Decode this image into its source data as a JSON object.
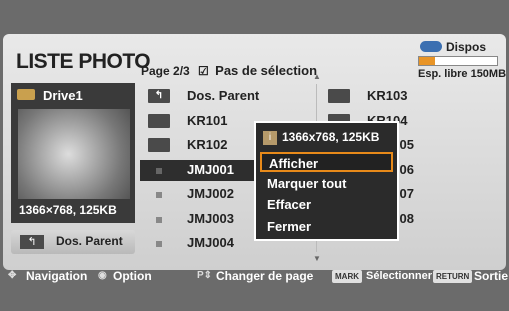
{
  "header": {
    "title": "LISTE PHOTO",
    "page": "Page 2/3",
    "checkbox_glyph": "☑",
    "selection_label": "Pas de sélection",
    "device_label": "Dispos USB",
    "free_space": "Esp. libre 150MB",
    "device_usage_fraction": 0.2
  },
  "preview": {
    "drive_name": "Drive1",
    "resolution": "1366×768, 125KB"
  },
  "parent_button": {
    "label": "Dos. Parent"
  },
  "list": {
    "left": [
      {
        "name": "Dos. Parent",
        "kind": "parent"
      },
      {
        "name": "KR101",
        "kind": "folder"
      },
      {
        "name": "KR102",
        "kind": "folder"
      },
      {
        "name": "JMJ001",
        "kind": "photo",
        "selected": true
      },
      {
        "name": "JMJ002",
        "kind": "photo"
      },
      {
        "name": "JMJ003",
        "kind": "photo"
      },
      {
        "name": "JMJ004",
        "kind": "photo"
      }
    ],
    "right": [
      {
        "name": "KR103",
        "kind": "folder"
      },
      {
        "name": "KR104",
        "kind": "folder"
      },
      {
        "name": "JMJ005",
        "kind": "photo"
      },
      {
        "name": "JMJ006",
        "kind": "photo"
      },
      {
        "name": "JMJ007",
        "kind": "photo"
      },
      {
        "name": "JMJ008",
        "kind": "photo"
      }
    ]
  },
  "popup": {
    "info": "1366x768, 125KB",
    "items": [
      "Afficher",
      "Marquer tout",
      "Effacer",
      "Fermer"
    ],
    "highlighted_index": 0
  },
  "footer": {
    "navigation": "Navigation",
    "option": "Option",
    "change_page": "Changer de page",
    "mark_key": "MARK",
    "select": "Sélectionner",
    "return_key": "RETURN",
    "exit": "Sortie"
  },
  "colors": {
    "selection_bg": "#2e2e2e",
    "highlight_border": "#e88a1a",
    "usb_icon": "#3b6fb1"
  }
}
